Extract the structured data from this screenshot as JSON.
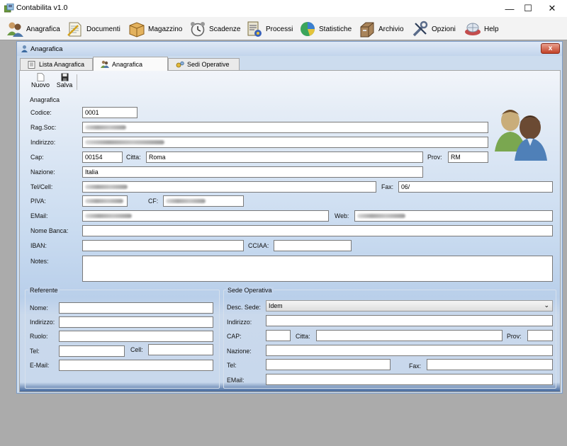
{
  "window": {
    "title": "Contabilita v1.0",
    "controls": {
      "minimize": "—",
      "maximize": "☐",
      "close": "✕"
    }
  },
  "menu": [
    {
      "label": "Anagrafica",
      "icon": "users-icon"
    },
    {
      "label": "Documenti",
      "icon": "document-icon"
    },
    {
      "label": "Magazzino",
      "icon": "box-icon"
    },
    {
      "label": "Scadenze",
      "icon": "alarm-clock-icon"
    },
    {
      "label": "Processi",
      "icon": "process-icon"
    },
    {
      "label": "Statistiche",
      "icon": "pie-chart-icon"
    },
    {
      "label": "Archivio",
      "icon": "archive-icon"
    },
    {
      "label": "Opzioni",
      "icon": "tools-icon"
    },
    {
      "label": "Help",
      "icon": "help-icon"
    }
  ],
  "child": {
    "title": "Anagrafica",
    "close": "x",
    "tabs": [
      {
        "label": "Lista Anagrafica",
        "icon": "list-icon",
        "active": false
      },
      {
        "label": "Anagrafica",
        "icon": "user-icon",
        "active": true
      },
      {
        "label": "Sedi Operative",
        "icon": "gears-icon",
        "active": false
      }
    ]
  },
  "toolbar": {
    "new_label": "Nuovo",
    "save_label": "Salva"
  },
  "anagrafica": {
    "section_label": "Anagrafica",
    "codice_label": "Codice:",
    "codice_value": "0001",
    "ragsoc_label": "Rag.Soc:",
    "indirizzo_label": "Indirizzo:",
    "cap_label": "Cap:",
    "cap_value": "00154",
    "citta_label": "Citta:",
    "citta_value": "Roma",
    "prov_label": "Prov:",
    "prov_value": "RM",
    "nazione_label": "Nazione:",
    "nazione_value": "Italia",
    "tel_label": "Tel/Cell:",
    "fax_label": "Fax:",
    "fax_value": "06/",
    "piva_label": "PIVA:",
    "cf_label": "CF:",
    "email_label": "EMail:",
    "web_label": "Web:",
    "banca_label": "Nome Banca:",
    "iban_label": "IBAN:",
    "cciaa_label": "CCIAA:",
    "notes_label": "Notes:"
  },
  "referente": {
    "group_label": "Referente",
    "nome_label": "Nome:",
    "indirizzo_label": "Indirizzo:",
    "ruolo_label": "Ruolo:",
    "tel_label": "Tel:",
    "cell_label": "Cell:",
    "email_label": "E-Mail:"
  },
  "sede": {
    "group_label": "Sede Operativa",
    "desc_label": "Desc. Sede:",
    "desc_value": "Idem",
    "indirizzo_label": "Indirizzo:",
    "cap_label": "CAP:",
    "citta_label": "Citta:",
    "prov_label": "Prov:",
    "nazione_label": "Nazione:",
    "tel_label": "Tel:",
    "fax_label": "Fax:",
    "email_label": "EMail:"
  }
}
